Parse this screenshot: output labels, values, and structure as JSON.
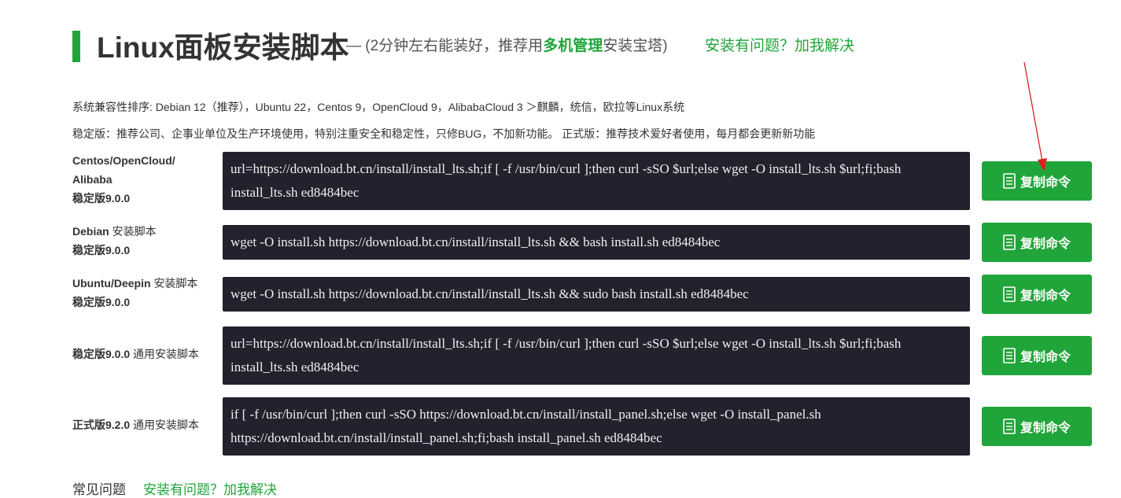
{
  "header": {
    "title": "Linux面板安装脚本",
    "subtitle_prefix": "— (2分钟左右能装好，推荐用",
    "subtitle_highlight": "多机管理",
    "subtitle_suffix": "安装宝塔)",
    "help_link": "安装有问题？加我解决"
  },
  "compat_text": "系统兼容性排序: Debian 12（推荐），Ubuntu 22，Centos 9，OpenCloud 9，AlibabaCloud 3 ＞麒麟，统信，欧拉等Linux系统",
  "stable_desc": "稳定版：推荐公司、企事业单位及生产环境使用，特别注重安全和稳定性，只修BUG，不加新功能。 正式版：推荐技术爱好者使用，每月都会更新新功能",
  "rows": [
    {
      "label_line1": "Centos/OpenCloud/",
      "label_line2": "Alibaba",
      "label_line3": "稳定版9.0.0",
      "command": "url=https://download.bt.cn/install/install_lts.sh;if [ -f /usr/bin/curl ];then curl -sSO $url;else wget -O install_lts.sh $url;fi;bash install_lts.sh ed8484bec",
      "button": "复制命令"
    },
    {
      "label_line1": "Debian ",
      "label_line1_normal": "安装脚本",
      "label_line2": "稳定版9.0.0",
      "command": "wget -O install.sh https://download.bt.cn/install/install_lts.sh && bash install.sh ed8484bec",
      "button": "复制命令"
    },
    {
      "label_line1": "Ubuntu/Deepin ",
      "label_line1_normal": "安装脚本",
      "label_line2": "稳定版9.0.0",
      "command": "wget -O install.sh https://download.bt.cn/install/install_lts.sh && sudo bash install.sh ed8484bec",
      "button": "复制命令"
    },
    {
      "label_line1": "稳定版9.0.0 ",
      "label_line1_normal": "通用安装脚本",
      "command": "url=https://download.bt.cn/install/install_lts.sh;if [ -f /usr/bin/curl ];then curl -sSO $url;else wget -O install_lts.sh $url;fi;bash install_lts.sh ed8484bec",
      "button": "复制命令"
    },
    {
      "label_line1": "正式版9.2.0 ",
      "label_line1_normal": "通用安装脚本",
      "command": "if [ -f /usr/bin/curl ];then curl -sSO https://download.bt.cn/install/install_panel.sh;else wget -O install_panel.sh https://download.bt.cn/install/install_panel.sh;fi;bash install_panel.sh ed8484bec",
      "button": "复制命令"
    }
  ],
  "faq": {
    "label": "常见问题",
    "link": "安装有问题？加我解决"
  },
  "colors": {
    "accent": "#20a53a",
    "code_bg": "#22212d",
    "arrow": "#e02020"
  },
  "icons": {
    "copy": "document-copy-icon"
  }
}
